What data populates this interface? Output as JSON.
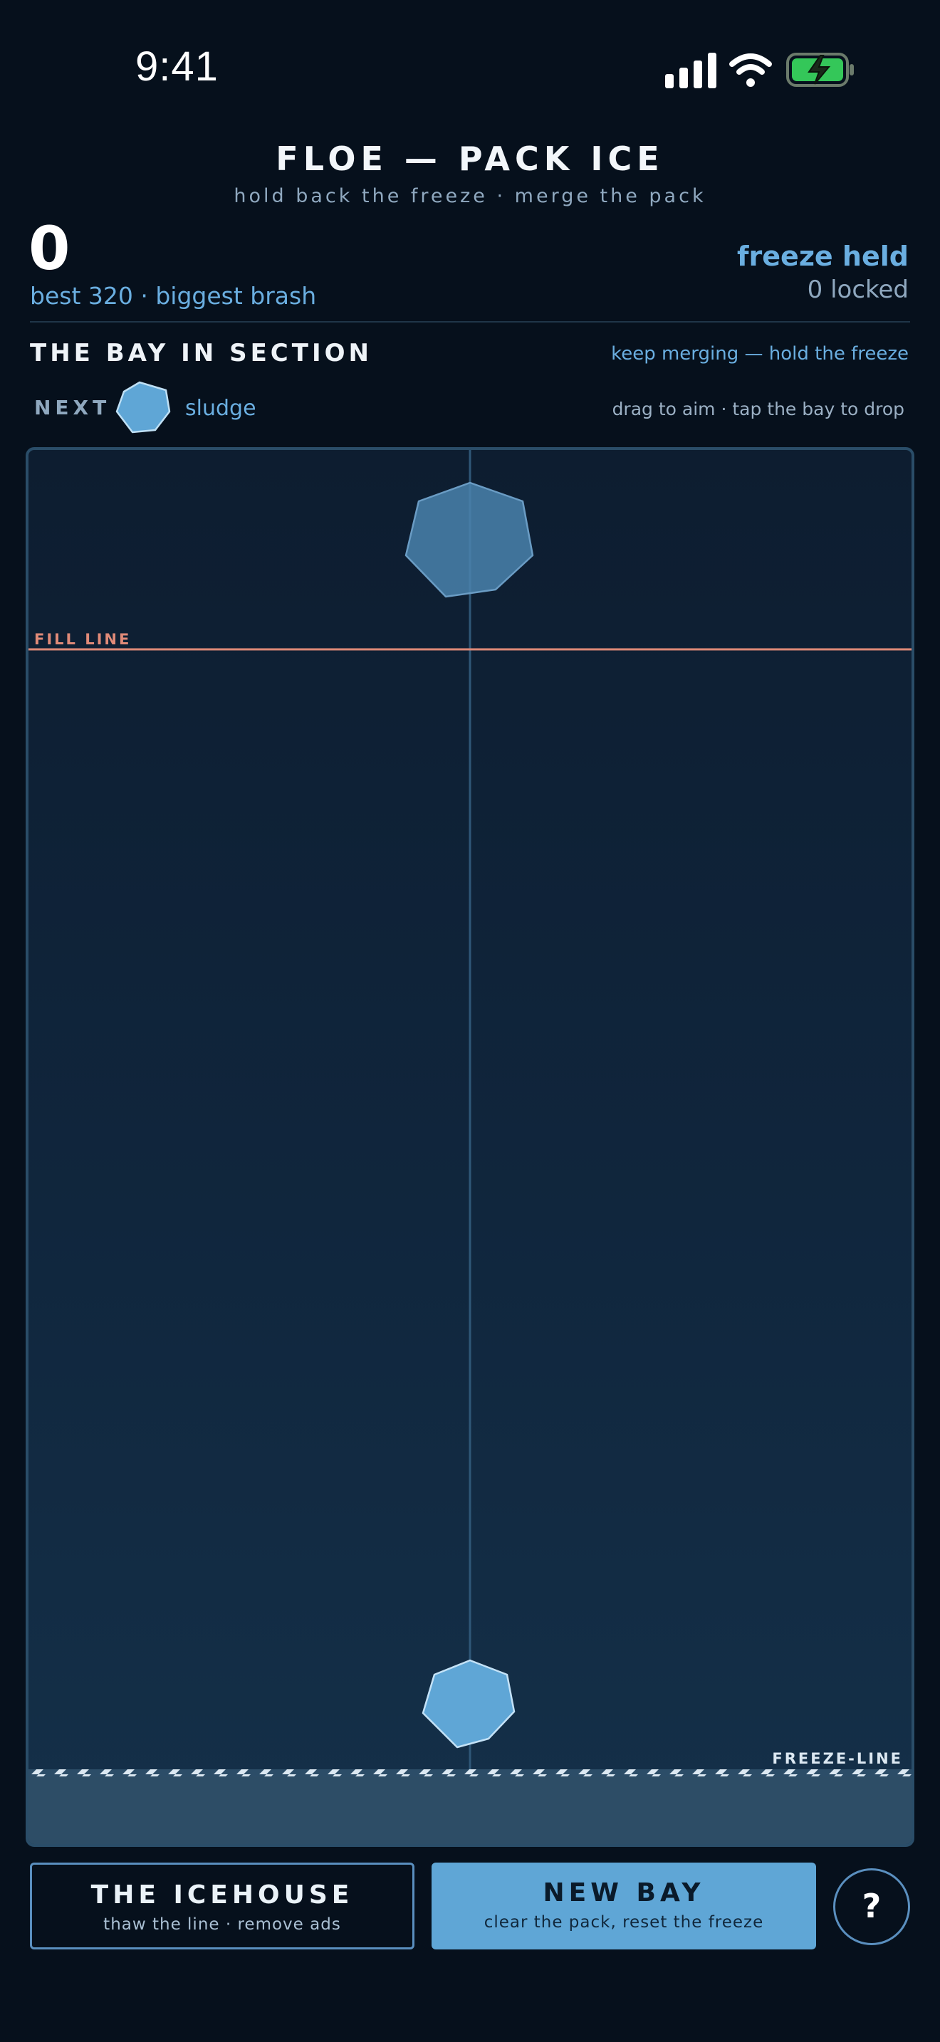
{
  "status_bar": {
    "time": "9:41",
    "icons": [
      "signal-icon",
      "wifi-icon",
      "battery-charging-icon"
    ]
  },
  "header": {
    "title": "FLOE — PACK ICE",
    "subtitle": "hold back the freeze · merge the pack"
  },
  "score": {
    "current": "0",
    "best_line": "best 320 · biggest brash",
    "freeze_status": "freeze held",
    "locked": "0 locked"
  },
  "section": {
    "title": "THE BAY IN SECTION",
    "hint": "keep merging — hold the freeze"
  },
  "next": {
    "label": "NEXT",
    "piece_name": "sludge",
    "aim_hint": "drag to aim · tap the bay to drop"
  },
  "bay": {
    "fill_line_label": "FILL LINE",
    "freeze_line_label": "FREEZE-LINE",
    "pieces": [
      {
        "name": "held-floe",
        "kind": "held"
      },
      {
        "name": "sludge",
        "kind": "settled"
      }
    ]
  },
  "buttons": {
    "icehouse": {
      "label": "THE ICEHOUSE",
      "sub": "thaw the line · remove ads"
    },
    "new_bay": {
      "label": "NEW BAY",
      "sub": "clear the pack, reset the freeze"
    },
    "help": "?"
  },
  "colors": {
    "background": "#06101c",
    "accent": "#6aaee0",
    "fill_line": "#e08a78",
    "button_primary": "#5fa6d6"
  }
}
